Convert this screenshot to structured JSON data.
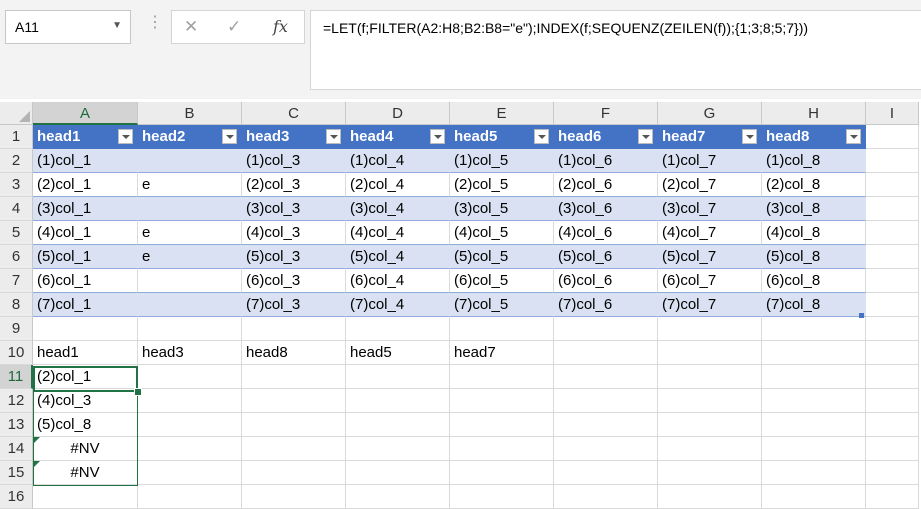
{
  "name_box": {
    "value": "A11"
  },
  "formula_bar": {
    "cancel_glyph": "✕",
    "enter_glyph": "✓",
    "fx_glyph": "fx",
    "formula": "=LET(f;FILTER(A2:H8;B2:B8=\"e\");INDEX(f;SEQUENZ(ZEILEN(f));{1;3;8;5;7}))"
  },
  "columns": [
    "A",
    "B",
    "C",
    "D",
    "E",
    "F",
    "G",
    "H",
    "I"
  ],
  "rows": [
    "1",
    "2",
    "3",
    "4",
    "5",
    "6",
    "7",
    "8",
    "9",
    "10",
    "11",
    "12",
    "13",
    "14",
    "15",
    "16"
  ],
  "selected": {
    "cell": "A11",
    "column": "A",
    "row": "11"
  },
  "table": {
    "headers": [
      "head1",
      "head2",
      "head3",
      "head4",
      "head5",
      "head6",
      "head7",
      "head8"
    ],
    "rows": [
      [
        "(1)col_1",
        "",
        "(1)col_3",
        "(1)col_4",
        "(1)col_5",
        "(1)col_6",
        "(1)col_7",
        "(1)col_8"
      ],
      [
        "(2)col_1",
        "e",
        "(2)col_3",
        "(2)col_4",
        "(2)col_5",
        "(2)col_6",
        "(2)col_7",
        "(2)col_8"
      ],
      [
        "(3)col_1",
        "",
        "(3)col_3",
        "(3)col_4",
        "(3)col_5",
        "(3)col_6",
        "(3)col_7",
        "(3)col_8"
      ],
      [
        "(4)col_1",
        "e",
        "(4)col_3",
        "(4)col_4",
        "(4)col_5",
        "(4)col_6",
        "(4)col_7",
        "(4)col_8"
      ],
      [
        "(5)col_1",
        "e",
        "(5)col_3",
        "(5)col_4",
        "(5)col_5",
        "(5)col_6",
        "(5)col_7",
        "(5)col_8"
      ],
      [
        "(6)col_1",
        "",
        "(6)col_3",
        "(6)col_4",
        "(6)col_5",
        "(6)col_6",
        "(6)col_7",
        "(6)col_8"
      ],
      [
        "(7)col_1",
        "",
        "(7)col_3",
        "(7)col_4",
        "(7)col_5",
        "(7)col_6",
        "(7)col_7",
        "(7)col_8"
      ]
    ]
  },
  "row10": [
    "head1",
    "head3",
    "head8",
    "head5",
    "head7"
  ],
  "result": [
    "(2)col_1",
    "(4)col_3",
    "(5)col_8",
    "#NV",
    "#NV"
  ],
  "colors": {
    "table_header": "#4472c4",
    "band": "#d9e1f2",
    "selection": "#217346"
  },
  "icons": {
    "cancel": "close-icon",
    "enter": "check-icon",
    "fx": "function-icon",
    "dropdown": "filter-dropdown-icon"
  }
}
